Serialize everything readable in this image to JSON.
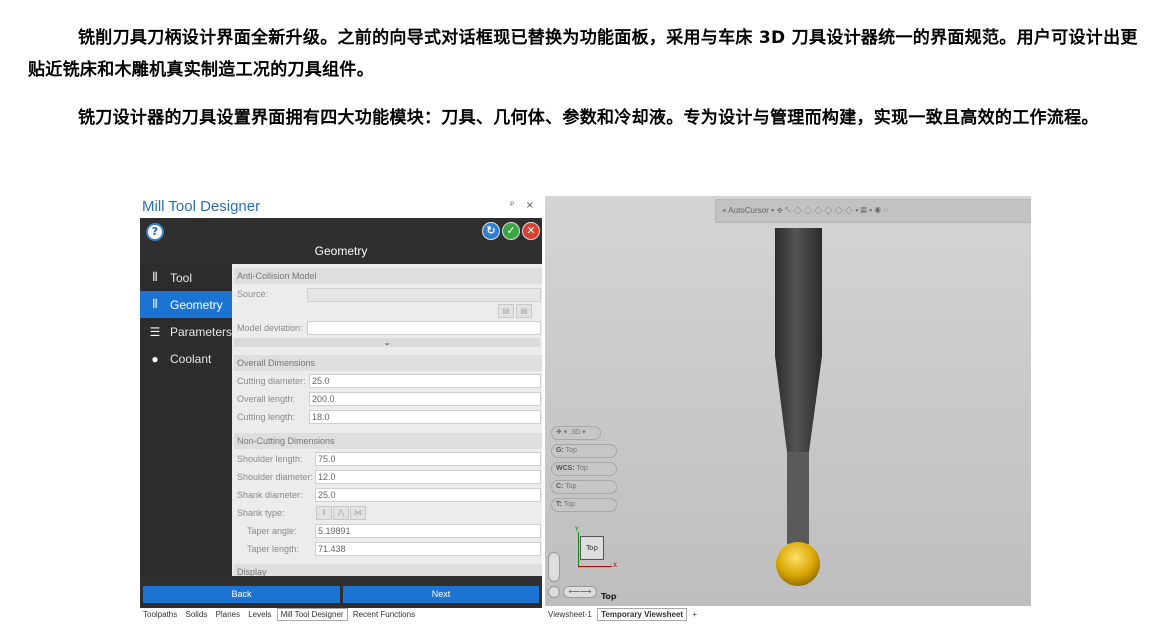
{
  "doc": {
    "p1": "铣削刀具刀柄设计界面全新升级。之前的向导式对话框现已替换为功能面板，采用与车床 3D 刀具设计器统一的界面规范。用户可设计出更贴近铣床和木雕机真实制造工况的刀具组件。",
    "p2": "铣刀设计器的刀具设置界面拥有四大功能模块：刀具、几何体、参数和冷却液。专为设计与管理而构建，实现一致且高效的工作流程。"
  },
  "panel": {
    "title": "Mill Tool Designer",
    "pin": "ᵖ ×",
    "header_title": "Geometry",
    "nav": [
      {
        "label": "Tool",
        "icon": "drill-bit-icon"
      },
      {
        "label": "Geometry",
        "icon": "geometry-icon"
      },
      {
        "label": "Parameters",
        "icon": "parameters-icon"
      },
      {
        "label": "Coolant",
        "icon": "coolant-drop-icon"
      }
    ],
    "sections": {
      "anti_collision": "Anti-Collision Model",
      "source_label": "Source:",
      "model_dev_label": "Model deviation:",
      "overall": "Overall Dimensions",
      "cutting_diameter_label": "Cutting diameter:",
      "cutting_diameter": "25.0",
      "overall_length_label": "Overall length:",
      "overall_length": "200.0",
      "cutting_length_label": "Cutting length:",
      "cutting_length": "18.0",
      "noncutting": "Non-Cutting Dimensions",
      "shoulder_length_label": "Shoulder length:",
      "shoulder_length": "75.0",
      "shoulder_diameter_label": "Shoulder diameter:",
      "shoulder_diameter": "12.0",
      "shank_diameter_label": "Shank diameter:",
      "shank_diameter": "25.0",
      "shank_type_label": "Shank type:",
      "taper_angle_label": "Taper angle:",
      "taper_angle": "5.19891",
      "taper_length_label": "Taper length:",
      "taper_length": "71.438",
      "display": "Display"
    },
    "back": "Back",
    "next": "Next"
  },
  "bottom_tabs": [
    "Toolpaths",
    "Solids",
    "Planes",
    "Levels",
    "Mill Tool Designer",
    "Recent Functions"
  ],
  "viewport": {
    "toolbar_text": "AutoCursor",
    "pill_3d": "3D",
    "g": "G:",
    "g_val": "Top",
    "wcs": "WCS:",
    "wcs_val": "Top",
    "c": "C:",
    "c_val": "Top",
    "t": "T:",
    "t_val": "Top",
    "cube_label": "Top",
    "axis_x": "X",
    "axis_y": "Y",
    "view_label": "Top"
  },
  "viewsheet_tabs": [
    "Viewsheet-1",
    "Temporary Viewsheet",
    "+"
  ],
  "colors": {
    "accent": "#1b74d2",
    "tool_body": "#3c3c3c",
    "ball": "#e0b000"
  }
}
